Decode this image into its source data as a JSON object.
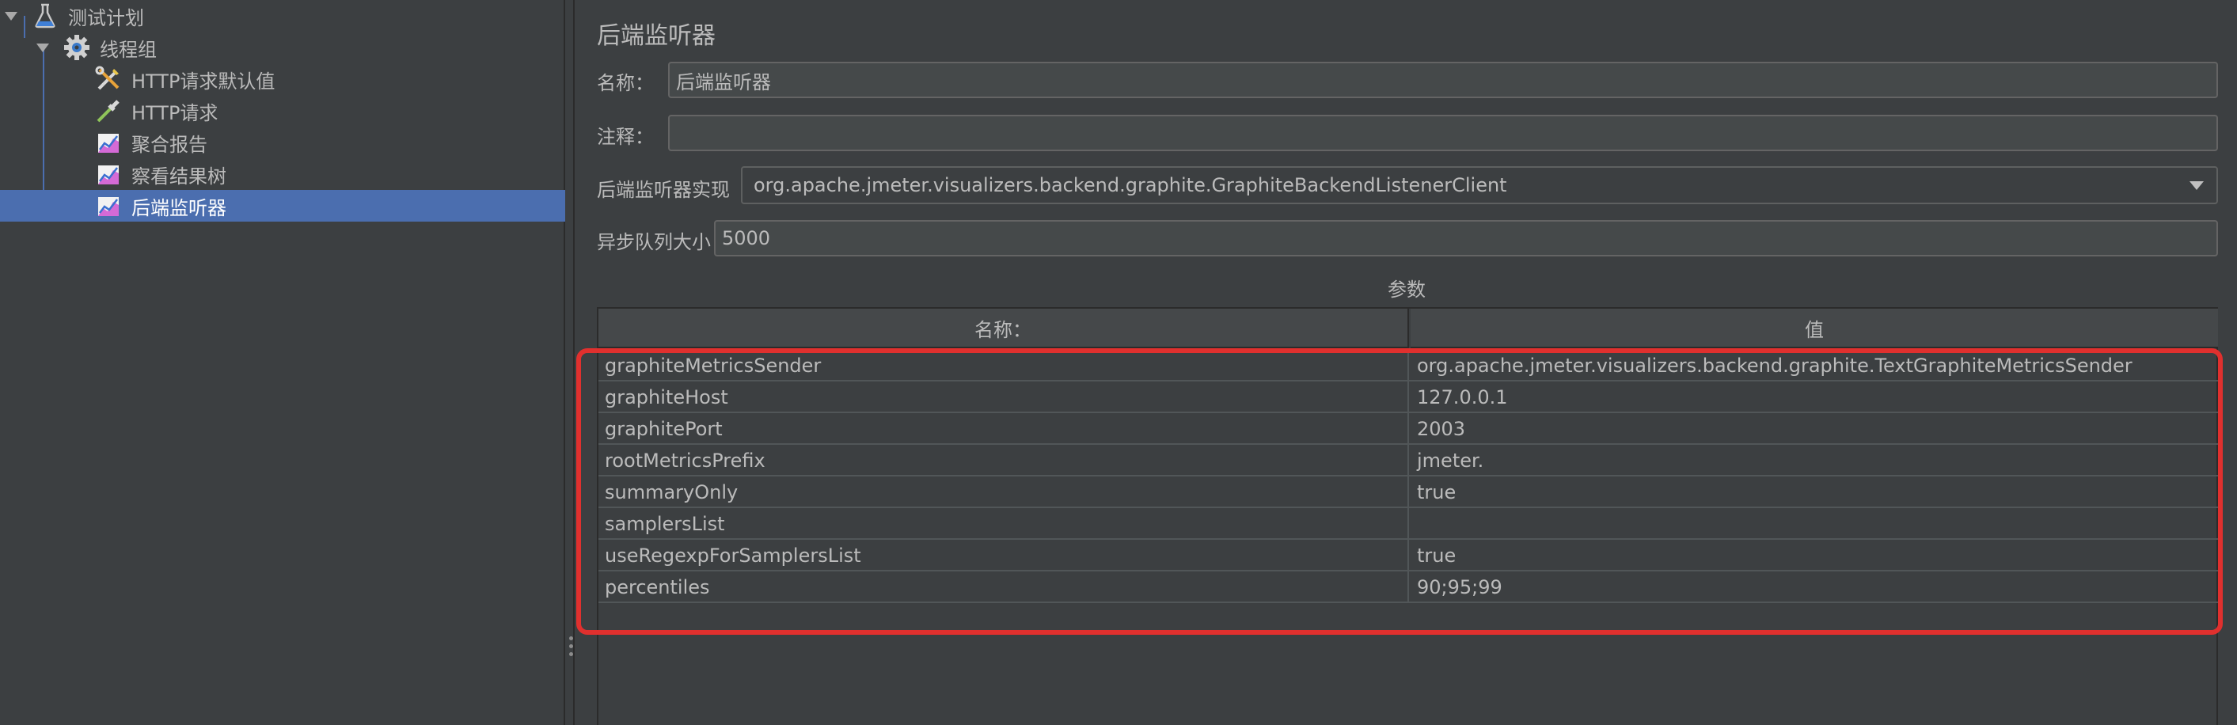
{
  "tree": {
    "items": [
      {
        "label": "测试计划",
        "icon": "flask-icon"
      },
      {
        "label": "线程组",
        "icon": "gear-icon"
      },
      {
        "label": "HTTP请求默认值",
        "icon": "wrench-screwdriver-icon"
      },
      {
        "label": "HTTP请求",
        "icon": "pipette-icon"
      },
      {
        "label": "聚合报告",
        "icon": "graph-report-icon"
      },
      {
        "label": "察看结果树",
        "icon": "graph-report-icon"
      },
      {
        "label": "后端监听器",
        "icon": "graph-report-icon",
        "selected": true
      }
    ]
  },
  "panel": {
    "title": "后端监听器",
    "name_label": "名称：",
    "name_value": "后端监听器",
    "comment_label": "注释：",
    "comment_value": "",
    "impl_label": "后端监听器实现",
    "impl_value": "org.apache.jmeter.visualizers.backend.graphite.GraphiteBackendListenerClient",
    "queue_label": "异步队列大小",
    "queue_value": "5000"
  },
  "params": {
    "title": "参数",
    "headers": [
      "名称：",
      "值"
    ],
    "rows": [
      {
        "name": "graphiteMetricsSender",
        "value": "org.apache.jmeter.visualizers.backend.graphite.TextGraphiteMetricsSender"
      },
      {
        "name": "graphiteHost",
        "value": "127.0.0.1"
      },
      {
        "name": "graphitePort",
        "value": "2003"
      },
      {
        "name": "rootMetricsPrefix",
        "value": "jmeter."
      },
      {
        "name": "summaryOnly",
        "value": "true"
      },
      {
        "name": "samplersList",
        "value": ""
      },
      {
        "name": "useRegexpForSamplersList",
        "value": "true"
      },
      {
        "name": "percentiles",
        "value": "90;95;99"
      }
    ]
  },
  "colors": {
    "background": "#3c3f41",
    "selection": "#4b6eaf",
    "highlight": "#e0302e"
  }
}
